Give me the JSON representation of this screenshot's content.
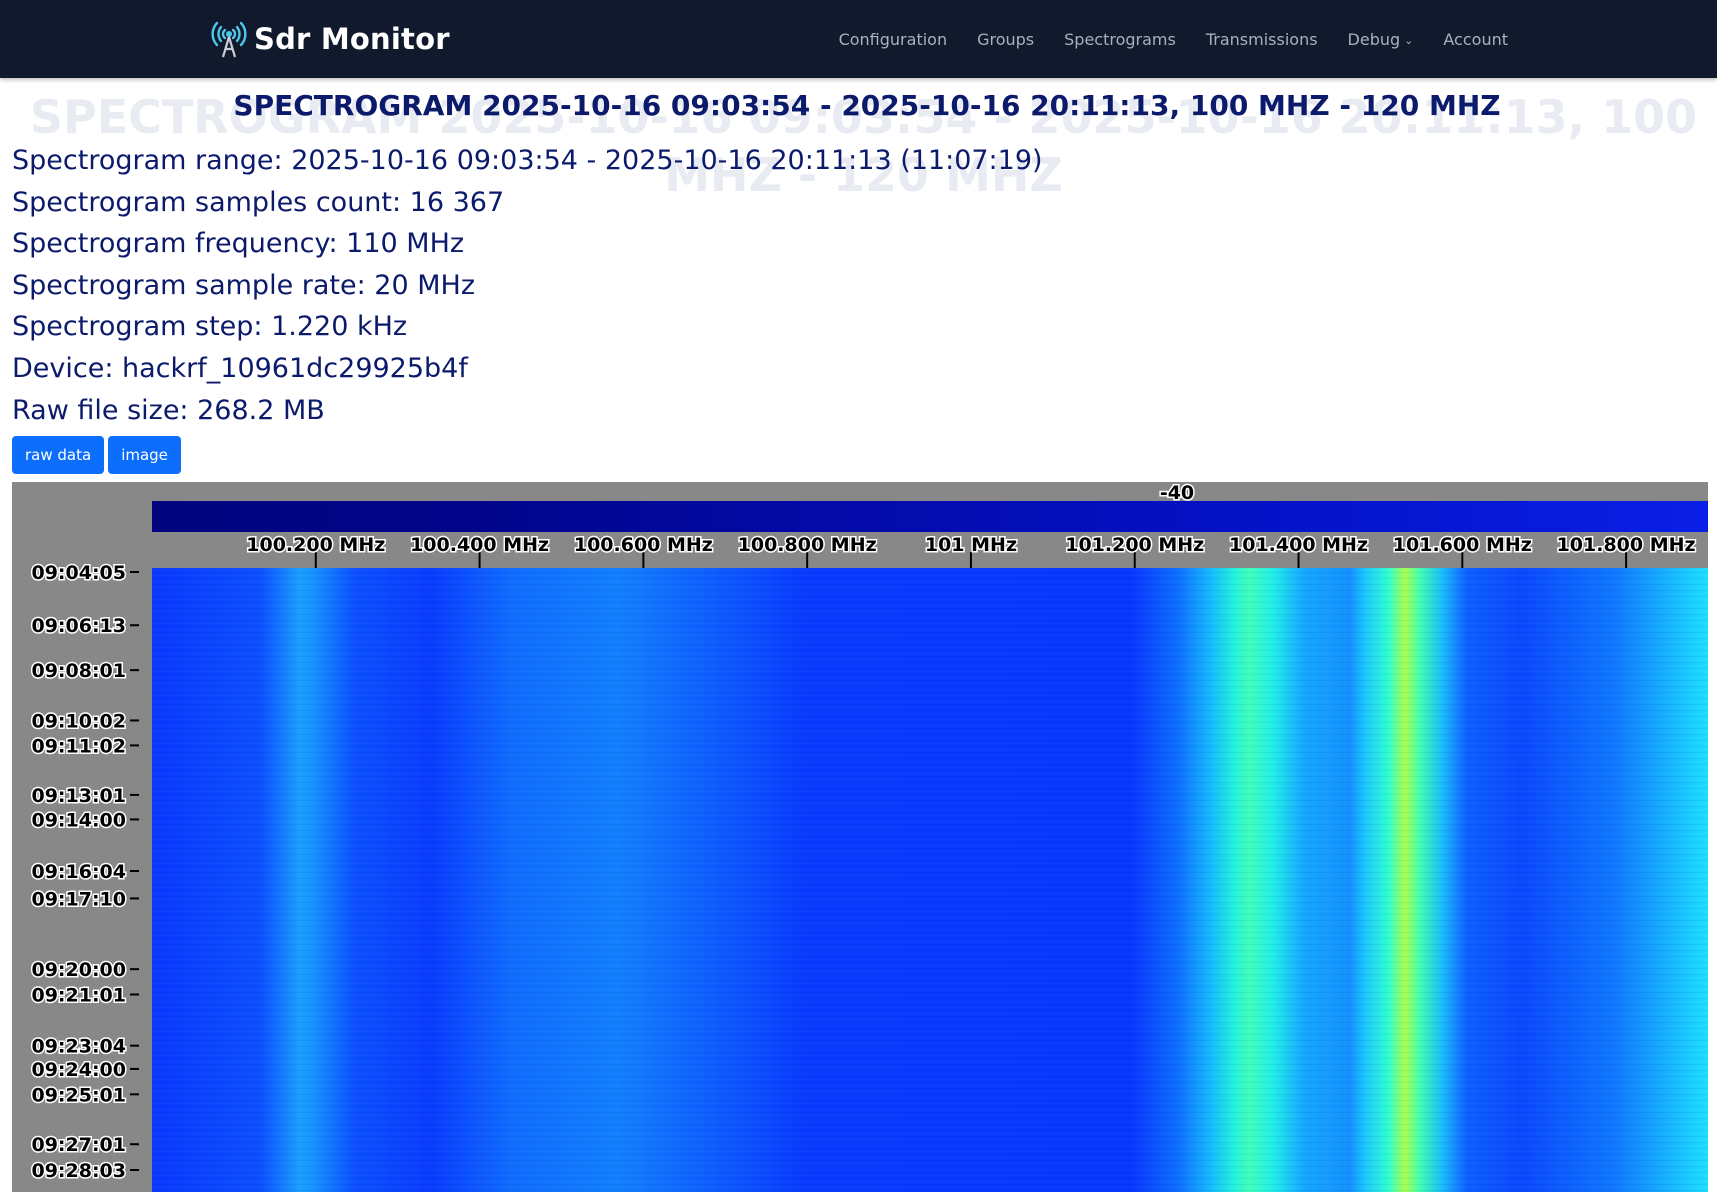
{
  "navbar": {
    "brand": "Sdr Monitor",
    "brand_icon": "radio-tower-icon",
    "links": [
      {
        "label": "Configuration"
      },
      {
        "label": "Groups"
      },
      {
        "label": "Spectrograms"
      },
      {
        "label": "Transmissions"
      },
      {
        "label": "Debug",
        "has_dropdown": true
      },
      {
        "label": "Account"
      }
    ]
  },
  "page": {
    "title": "SPECTROGRAM 2025-10-16 09:03:54 - 2025-10-16 20:11:13, 100 MHZ - 120 MHZ",
    "info": [
      "Spectrogram range: 2025-10-16 09:03:54 - 2025-10-16 20:11:13 (11:07:19)",
      "Spectrogram samples count: 16 367",
      "Spectrogram frequency: 110 MHz",
      "Spectrogram sample rate: 20 MHz",
      "Spectrogram step: 1.220 kHz",
      "Device: hackrf_10961dc29925b4f",
      "Raw file size: 268.2 MB"
    ],
    "buttons": {
      "raw_data": "raw data",
      "image": "image"
    }
  },
  "spectrogram": {
    "scale_value": "-40",
    "frequency_ticks": [
      "100.200 MHz",
      "100.400 MHz",
      "100.600 MHz",
      "100.800 MHz",
      "101 MHz",
      "101.200 MHz",
      "101.400 MHz",
      "101.600 MHz",
      "101.800 MHz"
    ],
    "frequency_tick_values_mhz": [
      100.2,
      100.4,
      100.6,
      100.8,
      101.0,
      101.2,
      101.4,
      101.6,
      101.8
    ],
    "visible_frequency_range_mhz": [
      100.0,
      101.9
    ],
    "time_ticks": [
      "09:04:05",
      "09:06:13",
      "09:08:01",
      "09:10:02",
      "09:11:02",
      "09:13:01",
      "09:14:00",
      "09:16:04",
      "09:17:10",
      "09:20:00",
      "09:21:01",
      "09:23:04",
      "09:24:00",
      "09:25:01",
      "09:27:01",
      "09:28:03"
    ],
    "colors": {
      "background": "#888888",
      "base": "#0a3cff",
      "cyan": "#19c8ff",
      "green": "#28ffb4",
      "yellow_green": "#a0ff50"
    }
  }
}
